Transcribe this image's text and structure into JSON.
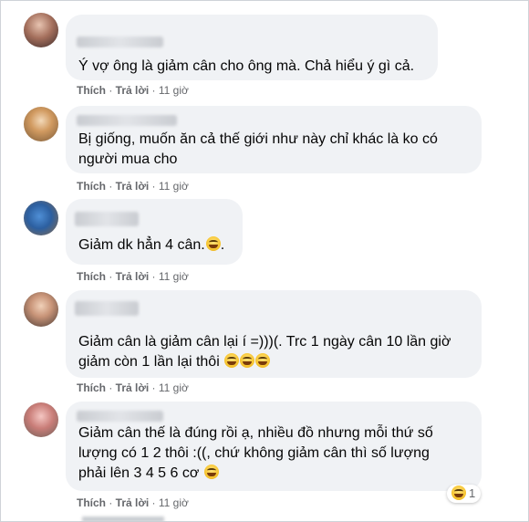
{
  "comments": [
    {
      "text": "Ý vợ ông là giảm cân cho ông mà. Chả hiểu ý gì cả.",
      "actions": {
        "like": "Thích",
        "sep1": " · ",
        "reply": "Trả lời",
        "sep2": " · ",
        "time": "11 giờ"
      }
    },
    {
      "text": "Bị giống, muốn ăn cả thế giới như này chỉ khác là ko có\nngười mua cho",
      "actions": {
        "like": "Thích",
        "sep1": " · ",
        "reply": "Trả lời",
        "sep2": " · ",
        "time": "11 giờ"
      }
    },
    {
      "text": "Giảm dk hẳn 4 cân.",
      "text_after": ".",
      "actions": {
        "like": "Thích",
        "sep1": " · ",
        "reply": "Trả lời",
        "sep2": " · ",
        "time": "11 giờ"
      }
    },
    {
      "text": "Giảm cân là giảm cân lại í =)))(. Trc 1 ngày cân 10 lần giờ\ngiảm còn 1 lần lại thôi ",
      "actions": {
        "like": "Thích",
        "sep1": " · ",
        "reply": "Trả lời",
        "sep2": " · ",
        "time": "11 giờ"
      }
    },
    {
      "text": "Giảm cân thế là đúng rồi ạ, nhiều đồ nhưng mỗi thứ số\nlượng có 1 2 thôi :((, chứ không giảm cân thì số lượng\nphải lên 3 4 5 6 cơ ",
      "actions": {
        "like": "Thích",
        "sep1": " · ",
        "reply": "Trả lời",
        "sep2": " · ",
        "time": "11 giờ"
      },
      "reaction": {
        "icon": "laughing-emoji-icon",
        "count": "1"
      }
    }
  ],
  "colors": {
    "bubble": "#f0f2f5",
    "meta": "#65676b",
    "text": "#050505"
  }
}
